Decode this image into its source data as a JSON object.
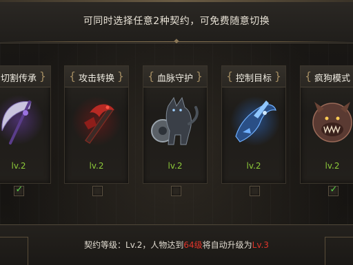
{
  "header": {
    "text": "可同时选择任意2种契约，可免费随意切换"
  },
  "cards": [
    {
      "title": "切割传承",
      "level": "lv.2",
      "checked": true,
      "icon": "scythe-icon"
    },
    {
      "title": "攻击转换",
      "level": "lv.2",
      "checked": false,
      "icon": "dragon-sword-icon"
    },
    {
      "title": "血脉守护",
      "level": "lv.2",
      "checked": false,
      "icon": "wolf-shield-icon"
    },
    {
      "title": "控制目标",
      "level": "lv.2",
      "checked": false,
      "icon": "blue-creature-icon"
    },
    {
      "title": "疯狗模式",
      "level": "lv.2",
      "checked": true,
      "icon": "beast-head-icon"
    }
  ],
  "footer": {
    "prefix": "契约等级：Lv.2，人物达到",
    "req_level": "64级",
    "middle": "将自动升级为",
    "next_level": "Lv.3"
  },
  "colors": {
    "level_green": "#8ecb3a",
    "check_green": "#59d64a",
    "highlight_red": "#e0352b"
  }
}
